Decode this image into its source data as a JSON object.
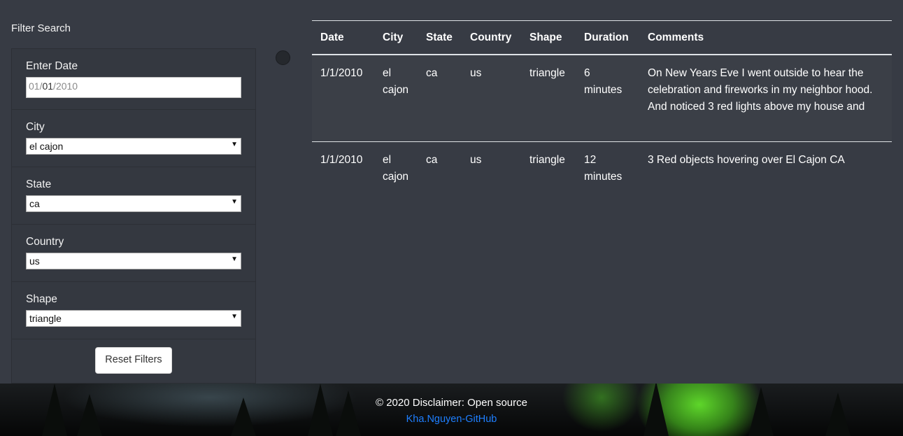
{
  "sidebar": {
    "title": "Filter Search",
    "date": {
      "label": "Enter Date",
      "value_month": "01",
      "value_sep1": "/",
      "value_day": "01",
      "value_sep2": "/",
      "value_year": "2010"
    },
    "city": {
      "label": "City",
      "selected": "el cajon"
    },
    "state": {
      "label": "State",
      "selected": "ca"
    },
    "country": {
      "label": "Country",
      "selected": "us"
    },
    "shape": {
      "label": "Shape",
      "selected": "triangle"
    },
    "reset_label": "Reset Filters"
  },
  "table": {
    "headers": [
      "Date",
      "City",
      "State",
      "Country",
      "Shape",
      "Duration",
      "Comments"
    ],
    "rows": [
      [
        "1/1/2010",
        "el cajon",
        "ca",
        "us",
        "triangle",
        "6 minutes",
        "On New Years Eve I went outside to hear the celebration and fireworks in my neighbor hood. And noticed 3 red lights above my house and"
      ],
      [
        "1/1/2010",
        "el cajon",
        "ca",
        "us",
        "triangle",
        "12 minutes",
        "3 Red objects hovering over El Cajon CA"
      ]
    ]
  },
  "footer": {
    "copyright": "© 2020 Disclaimer: Open source",
    "link_text": "Kha.Nguyen-GitHub"
  },
  "icons": {
    "select_arrow": "chevron-down-icon",
    "toggle": "circle-toggle-icon"
  }
}
